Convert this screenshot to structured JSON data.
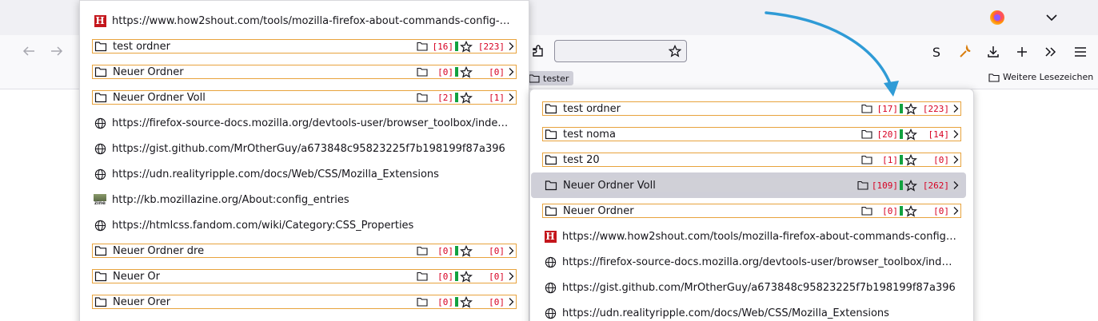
{
  "colors": {
    "folder_border": "#e8a33d",
    "count_red": "#d70022",
    "bar_green": "#12a240",
    "arrow_blue": "#2f9bd6",
    "highlight": "#cfcfd8"
  },
  "toolbar": {
    "profile_letter": "S",
    "icons": [
      "back-icon",
      "forward-icon",
      "puzzle-icon",
      "bookmark-star-icon",
      "wrench-icon",
      "download-icon",
      "plus-icon",
      "overflow-icon",
      "hamburger-menu-icon",
      "firefox-logo",
      "tab-list-chevron-icon"
    ]
  },
  "bookmarks_bar": {
    "folder_tester": "tester",
    "other_bookmarks": "Weitere Lesezeichen"
  },
  "left_menu": {
    "rows": [
      {
        "type": "link",
        "icon": "h-favicon",
        "label": "https://www.how2shout.com/tools/mozilla-firefox-about-commands-config-se..."
      },
      {
        "type": "folder",
        "label": "test ordner",
        "folders": "[16]",
        "bookmarks": "[223]"
      },
      {
        "type": "folder",
        "label": "Neuer Ordner",
        "folders": "[0]",
        "bookmarks": "[0]"
      },
      {
        "type": "folder",
        "label": "Neuer Ordner Voll",
        "folders": "[2]",
        "bookmarks": "[1]"
      },
      {
        "type": "link",
        "icon": "globe-icon",
        "label": "https://firefox-source-docs.mozilla.org/devtools-user/browser_toolbox/index.ht..."
      },
      {
        "type": "link",
        "icon": "globe-icon",
        "label": "https://gist.github.com/MrOtherGuy/a673848c95823225f7b198199f87a396"
      },
      {
        "type": "link",
        "icon": "globe-icon",
        "label": "https://udn.realityripple.com/docs/Web/CSS/Mozilla_Extensions"
      },
      {
        "type": "link",
        "icon": "zine-favicon",
        "label": "http://kb.mozillazine.org/About:config_entries"
      },
      {
        "type": "link",
        "icon": "globe-icon",
        "label": "https://htmlcss.fandom.com/wiki/Category:CSS_Properties"
      },
      {
        "type": "folder",
        "label": "Neuer Ordner  dre",
        "folders": "[0]",
        "bookmarks": "[0]"
      },
      {
        "type": "folder",
        "label": "Neuer Or",
        "folders": "[0]",
        "bookmarks": "[0]"
      },
      {
        "type": "folder",
        "label": "Neuer Orer",
        "folders": "[0]",
        "bookmarks": "[0]"
      }
    ]
  },
  "right_menu": {
    "rows": [
      {
        "type": "folder",
        "label": "test ordner",
        "folders": "[17]",
        "bookmarks": "[223]"
      },
      {
        "type": "folder",
        "label": "test noma",
        "folders": "[20]",
        "bookmarks": "[14]"
      },
      {
        "type": "folder",
        "label": "test 20",
        "folders": "[1]",
        "bookmarks": "[0]"
      },
      {
        "type": "folder",
        "label": "Neuer Ordner Voll",
        "folders": "[109]",
        "bookmarks": "[262]",
        "highlighted": true
      },
      {
        "type": "folder",
        "label": "Neuer Ordner",
        "folders": "[0]",
        "bookmarks": "[0]"
      },
      {
        "type": "link",
        "icon": "h-favicon",
        "label": "https://www.how2shout.com/tools/mozilla-firefox-about-commands-config-se..."
      },
      {
        "type": "link",
        "icon": "globe-icon",
        "label": "https://firefox-source-docs.mozilla.org/devtools-user/browser_toolbox/index.ht..."
      },
      {
        "type": "link",
        "icon": "globe-icon",
        "label": "https://gist.github.com/MrOtherGuy/a673848c95823225f7b198199f87a396"
      },
      {
        "type": "link",
        "icon": "globe-icon",
        "label": "https://udn.realityripple.com/docs/Web/CSS/Mozilla_Extensions"
      }
    ]
  },
  "favicon_text": {
    "h": "H",
    "zine": "zine"
  }
}
